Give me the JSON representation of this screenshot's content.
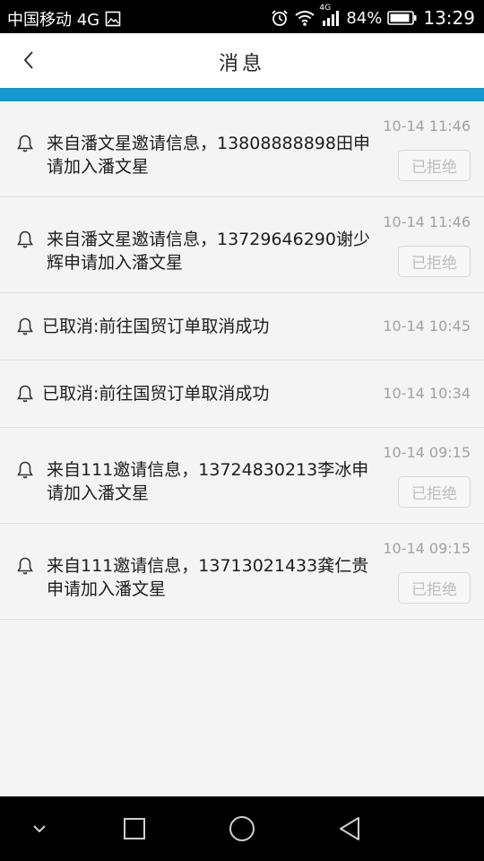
{
  "status_bar": {
    "carrier": "中国移动 4G",
    "network_badge": "4G",
    "battery": "84%",
    "time": "13:29",
    "icons": [
      "picture-icon",
      "alarm-icon",
      "wifi-icon",
      "signal-icon",
      "battery-icon"
    ]
  },
  "header": {
    "title": "消息"
  },
  "colors": {
    "accent": "#1597cf",
    "time_text": "#a2a2a2",
    "button_text": "#bdbdbd"
  },
  "messages": [
    {
      "text": "来自潘文星邀请信息，13808888898田申请加入潘文星",
      "time": "10-14 11:46",
      "status": "已拒绝"
    },
    {
      "text": "来自潘文星邀请信息，13729646290谢少辉申请加入潘文星",
      "time": "10-14 11:46",
      "status": "已拒绝"
    },
    {
      "text": "已取消:前往国贸订单取消成功",
      "time": "10-14 10:45"
    },
    {
      "text": "已取消:前往国贸订单取消成功",
      "time": "10-14 10:34"
    },
    {
      "text": "来自111邀请信息，13724830213李冰申请加入潘文星",
      "time": "10-14 09:15",
      "status": "已拒绝"
    },
    {
      "text": "来自111邀请信息，13713021433龚仁贵申请加入潘文星",
      "time": "10-14 09:15",
      "status": "已拒绝"
    }
  ],
  "system_nav": {
    "icons": [
      "chevron-down-icon",
      "square-icon",
      "circle-icon",
      "triangle-back-icon"
    ]
  }
}
